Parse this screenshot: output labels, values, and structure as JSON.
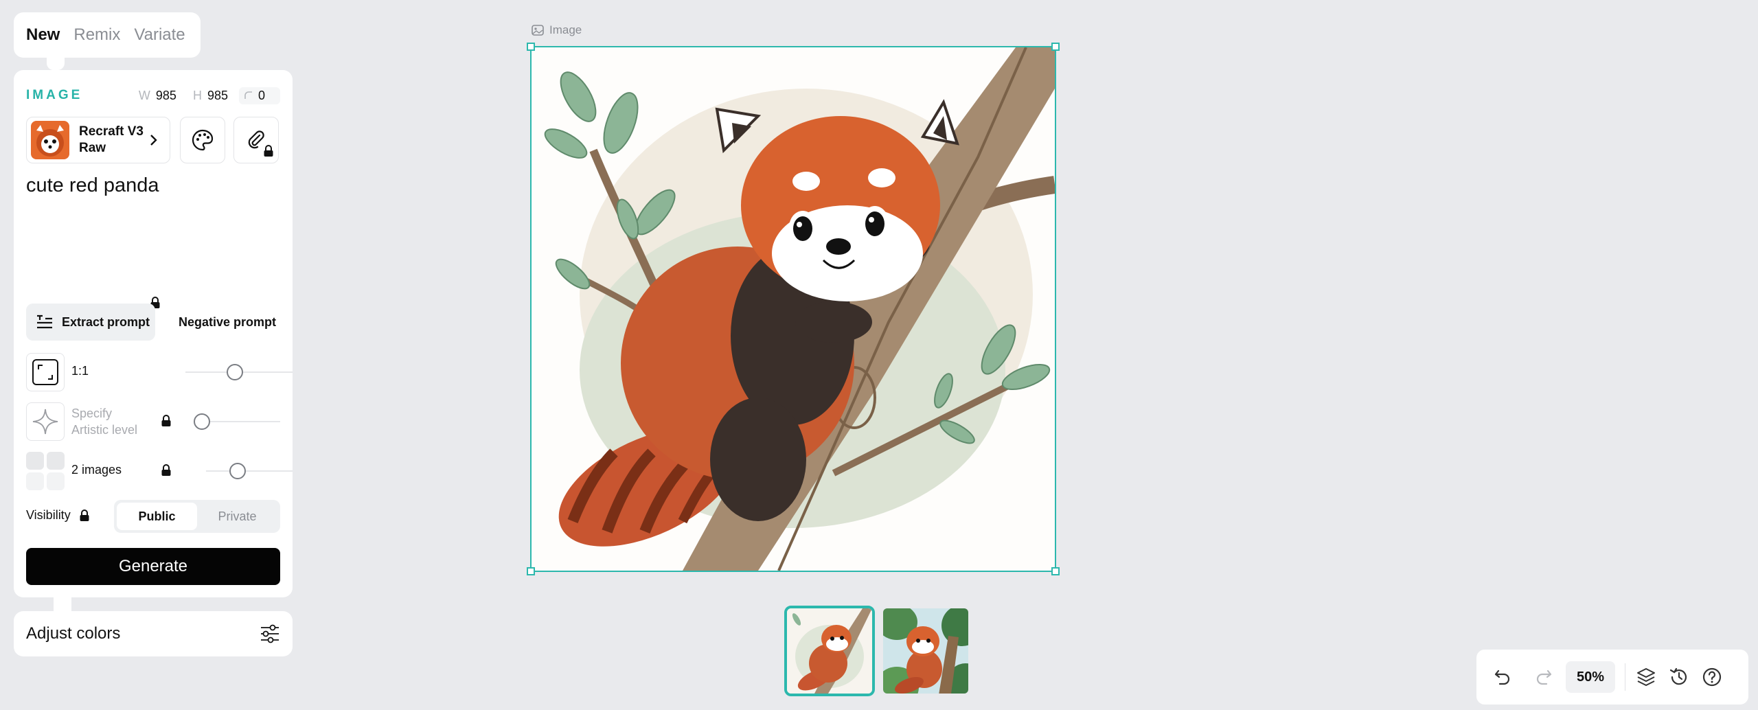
{
  "mode_tabs": [
    "New",
    "Remix",
    "Variate"
  ],
  "panel": {
    "section_label": "IMAGE",
    "width": {
      "key": "W",
      "value": "985"
    },
    "height": {
      "key": "H",
      "value": "985"
    },
    "corner": {
      "value": "0"
    },
    "model": {
      "name": "Recraft V3 Raw"
    },
    "prompt": "cute red panda",
    "extract_prompt": "Extract prompt",
    "negative_prompt": "Negative prompt",
    "aspect_ratio": "1:1",
    "artistic_level": "Specify Artistic level",
    "num_images": "2 images",
    "visibility": {
      "label": "Visibility",
      "options": [
        "Public",
        "Private"
      ],
      "selected": "Public"
    },
    "generate": "Generate"
  },
  "adjust_colors": "Adjust colors",
  "canvas": {
    "label": "Image",
    "accent": "#2cb8ad"
  },
  "toolbar": {
    "zoom": "50%"
  }
}
